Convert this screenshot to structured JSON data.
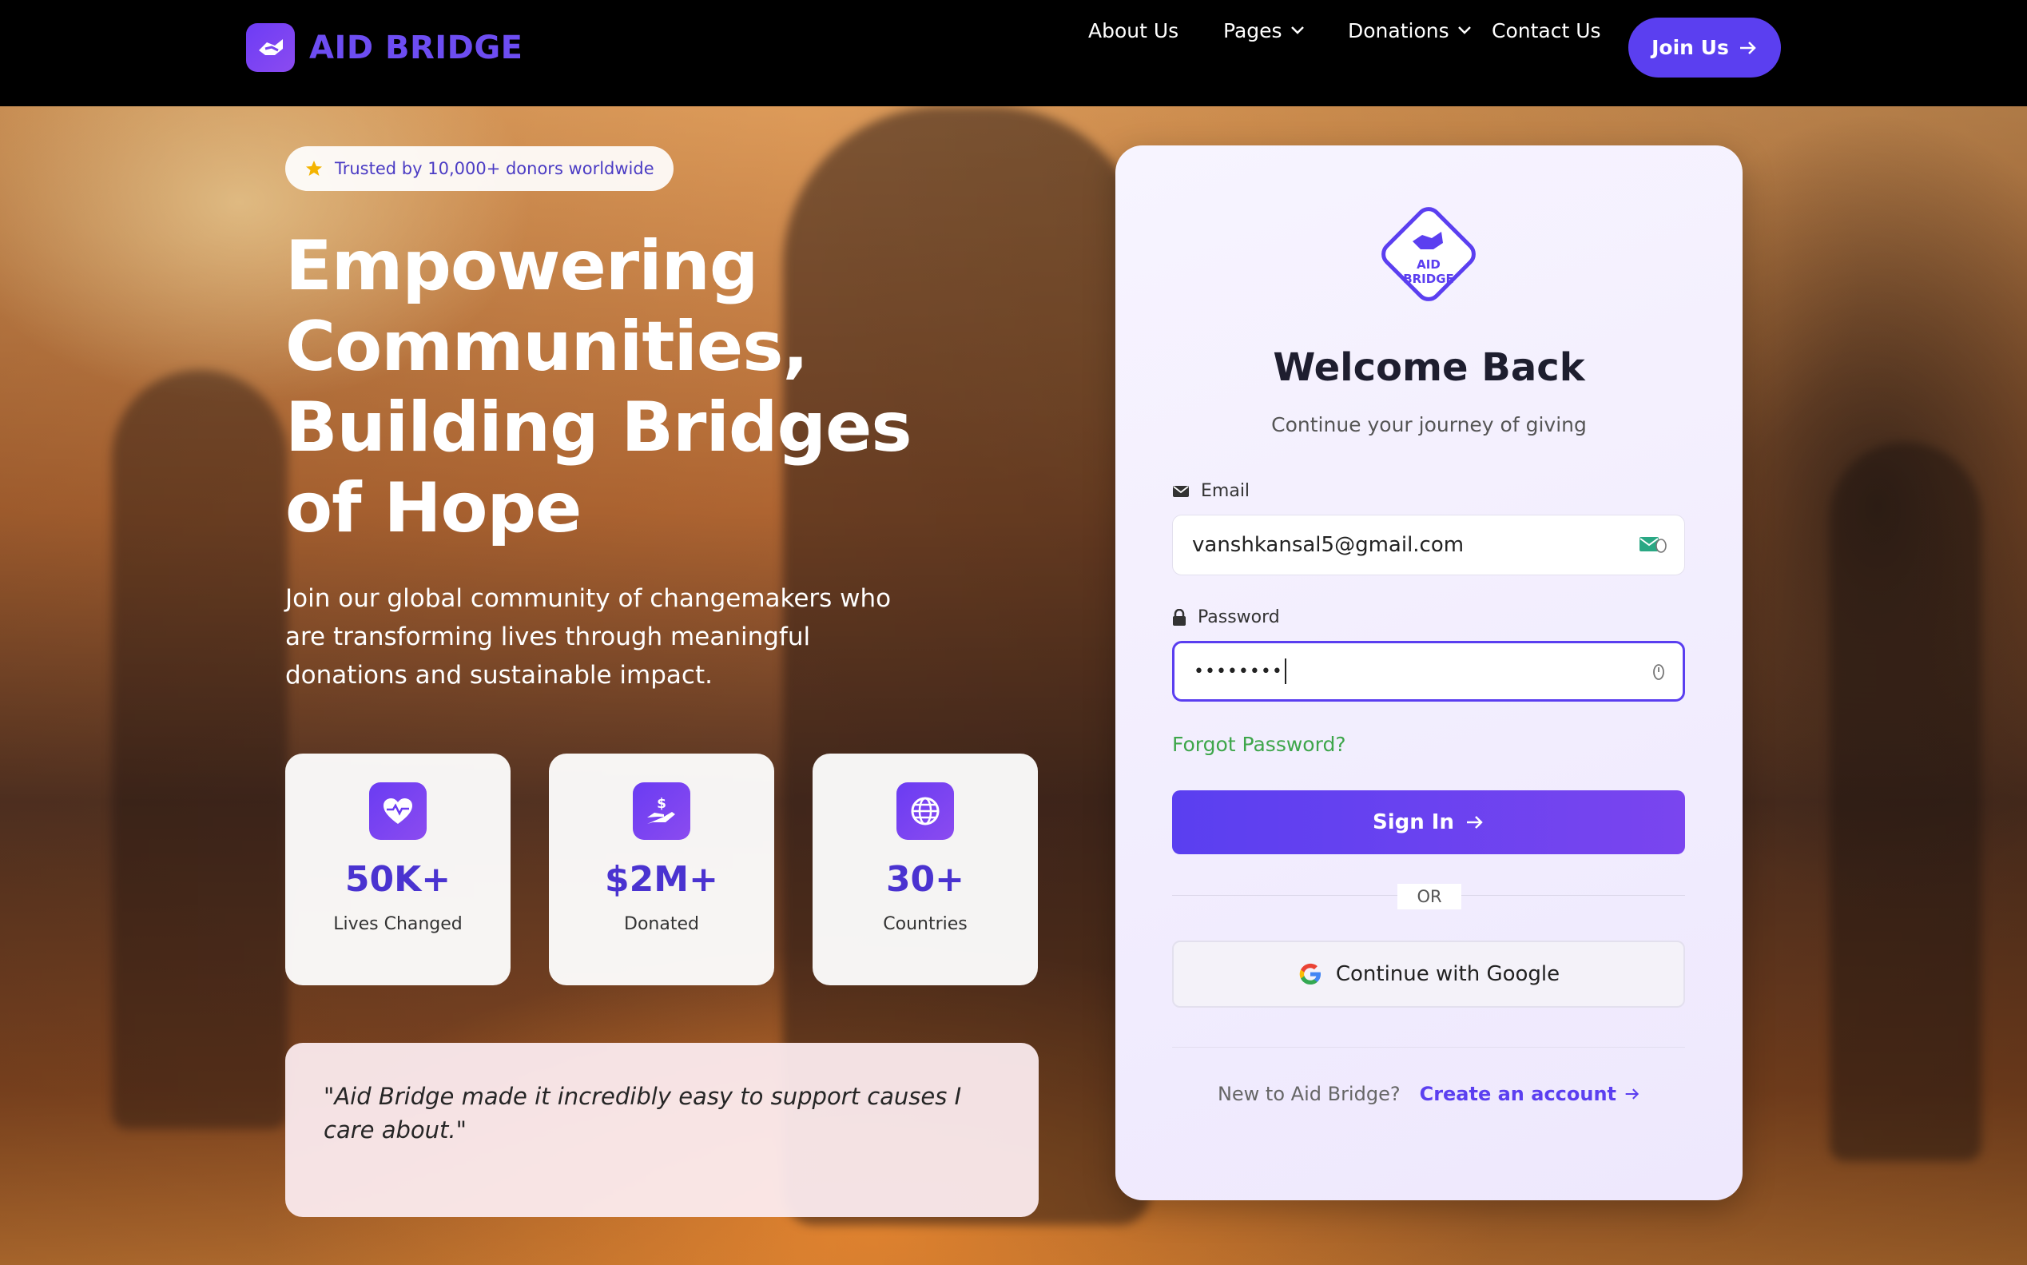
{
  "brand": {
    "name": "AID BRIDGE",
    "logo_icon": "handshake-icon"
  },
  "nav": {
    "about": "About Us",
    "pages": "Pages",
    "donations": "Donations",
    "contact": "Contact Us",
    "join": "Join Us"
  },
  "hero": {
    "badge": "Trusted by 10,000+ donors worldwide",
    "title": "Empowering Communities, Building Bridges of Hope",
    "subtitle": "Join our global community of changemakers who are transforming lives through meaningful donations and sustainable impact.",
    "stats": [
      {
        "icon": "heart-pulse-icon",
        "value": "50K+",
        "label": "Lives Changed"
      },
      {
        "icon": "donation-hand-icon",
        "value": "$2M+",
        "label": "Donated"
      },
      {
        "icon": "globe-icon",
        "value": "30+",
        "label": "Countries"
      }
    ],
    "quote": "\"Aid Bridge made it incredibly easy to support causes I care about.\""
  },
  "login": {
    "logo_line1": "AID",
    "logo_line2": "BRIDGE",
    "title": "Welcome Back",
    "subtitle": "Continue your journey of giving",
    "email_label": "Email",
    "email_value": "vanshkansal5@gmail.com",
    "password_label": "Password",
    "password_value": "••••••••",
    "forgot": "Forgot Password?",
    "sign_in": "Sign In",
    "or": "OR",
    "google": "Continue with Google",
    "new_user": "New to Aid Bridge?",
    "create_account": "Create an account"
  },
  "colors": {
    "accent": "#5b3ff0",
    "success": "#3ea64b"
  }
}
